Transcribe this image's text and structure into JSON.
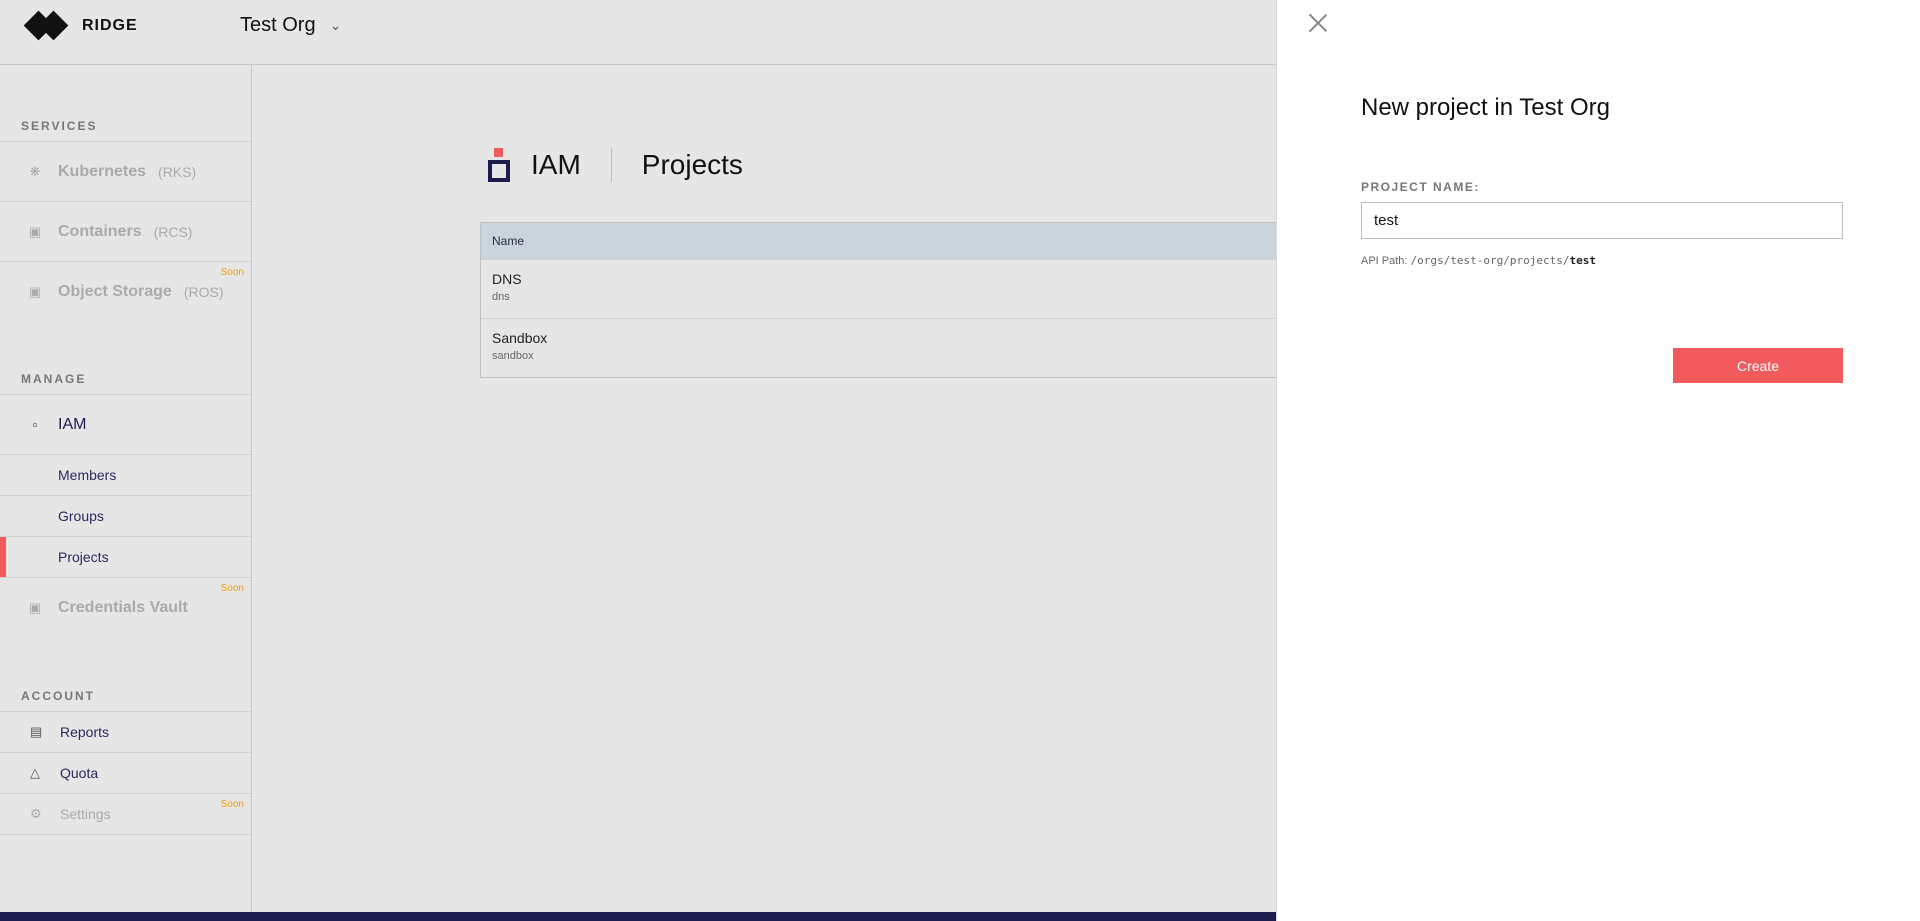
{
  "brand": {
    "name": "RIDGE"
  },
  "org_switcher": {
    "name": "Test Org"
  },
  "sidebar": {
    "services_title": "SERVICES",
    "services": [
      {
        "label": "Kubernetes",
        "sub": "(RKS)",
        "soon": ""
      },
      {
        "label": "Containers",
        "sub": "(RCS)",
        "soon": ""
      },
      {
        "label": "Object Storage",
        "sub": "(ROS)",
        "soon": "Soon"
      }
    ],
    "manage_title": "MANAGE",
    "iam_label": "IAM",
    "iam_items": [
      {
        "label": "Members"
      },
      {
        "label": "Groups"
      },
      {
        "label": "Projects"
      }
    ],
    "vault": {
      "label": "Credentials Vault",
      "soon": "Soon"
    },
    "account_title": "ACCOUNT",
    "account": [
      {
        "label": "Reports",
        "soon": ""
      },
      {
        "label": "Quota",
        "soon": ""
      },
      {
        "label": "Settings",
        "soon": "Soon"
      }
    ]
  },
  "main": {
    "section": "IAM",
    "title": "Projects",
    "table": {
      "header": "Name",
      "rows": [
        {
          "name": "DNS",
          "slug": "dns"
        },
        {
          "name": "Sandbox",
          "slug": "sandbox"
        }
      ]
    }
  },
  "drawer": {
    "title": "New project in Test Org",
    "field_label": "PROJECT NAME:",
    "field_value": "test",
    "api_prefix": "API Path: ",
    "api_path": "/orgs/test-org/projects/",
    "api_slug": "test",
    "create_label": "Create"
  },
  "colors": {
    "accent": "#f15b5e",
    "navy": "#1c1c4e",
    "soon": "#e8a013"
  }
}
